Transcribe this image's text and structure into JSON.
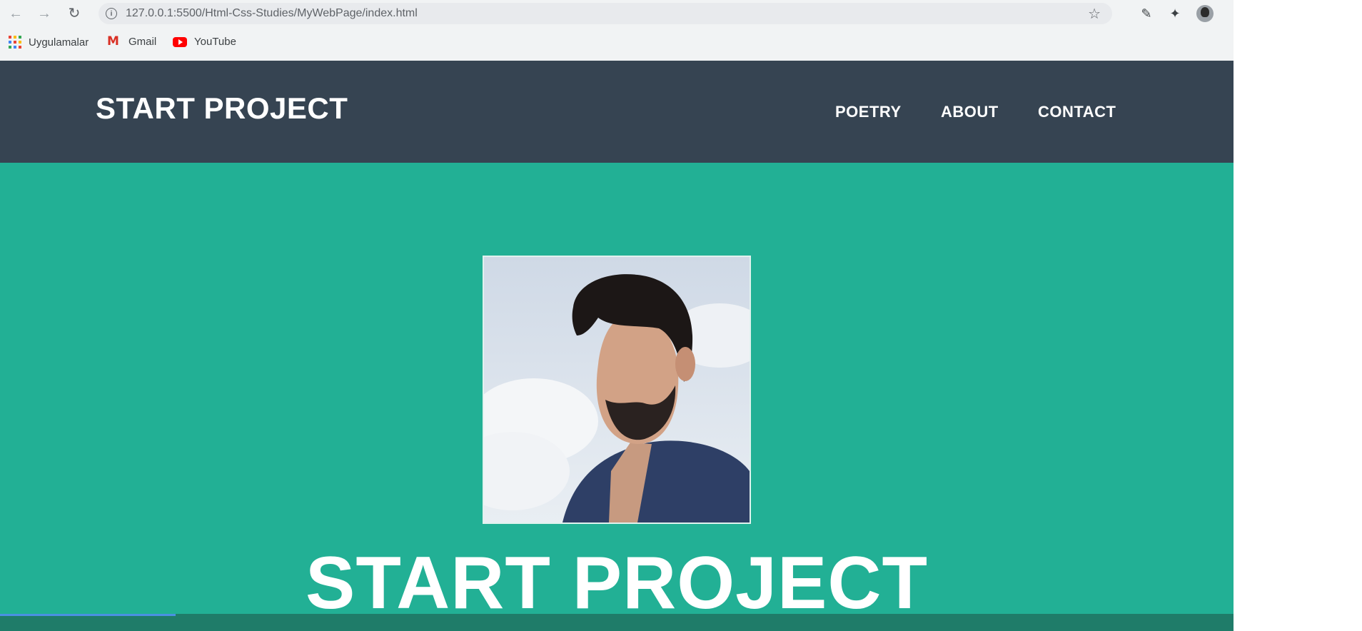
{
  "browser": {
    "url": "127.0.0.1:5500/Html-Css-Studies/MyWebPage/index.html",
    "bookmarks": [
      {
        "label": "Uygulamalar",
        "icon": "apps-grid-icon"
      },
      {
        "label": "Gmail",
        "icon": "gmail-icon"
      },
      {
        "label": "YouTube",
        "icon": "youtube-icon"
      }
    ]
  },
  "site": {
    "brand": "START PROJECT",
    "nav": [
      "POETRY",
      "ABOUT",
      "CONTACT"
    ],
    "hero_title": "START PROJECT"
  },
  "colors": {
    "nav_bg": "#364452",
    "hero_bg": "#22b095",
    "text": "#ffffff"
  }
}
